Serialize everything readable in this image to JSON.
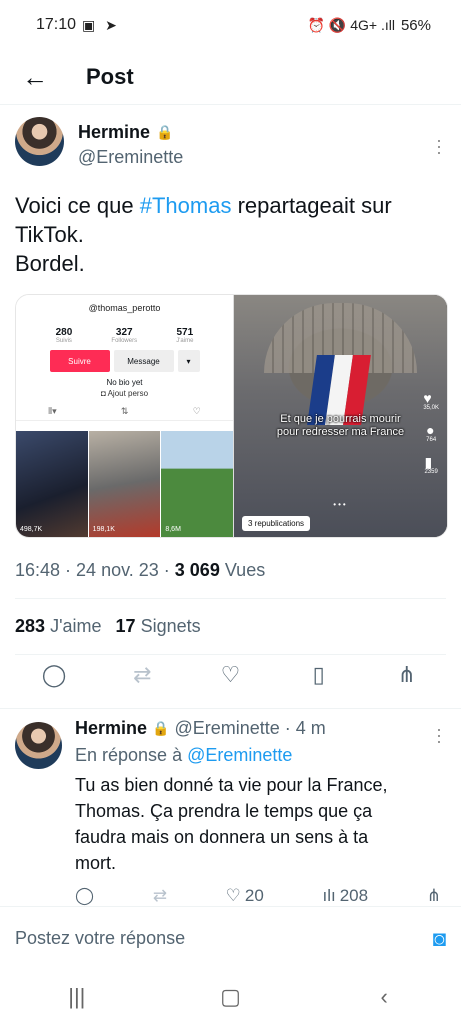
{
  "status_bar": {
    "time": "17:10",
    "left_icons": "▣ ➤",
    "right_icons": "⏰ 🔇 4G+ .ıll",
    "battery": "56%"
  },
  "header": {
    "back_icon": "arrow-left-icon",
    "title": "Post"
  },
  "tweet": {
    "author_name": "Hermine",
    "author_handle": "@Ereminette",
    "text_before": "Voici ce que ",
    "hashtag": "#Thomas",
    "text_after": " repartageait sur TikTok.\nBordel.",
    "media": {
      "tiktok_profile": {
        "handle": "@thomas_perotto",
        "stats": [
          {
            "num": "280",
            "label": "Suivis"
          },
          {
            "num": "327",
            "label": "Followers"
          },
          {
            "num": "571",
            "label": "J'aime"
          }
        ],
        "follow": "Suivre",
        "message": "Message",
        "bio": "No bio yet",
        "add": "Ajout perso",
        "videos": [
          "498,7K",
          "198,1K",
          "8,6M"
        ]
      },
      "video": {
        "caption_line1": "Et que je pourrais mourir",
        "caption_line2": "pour redresser ma France",
        "likes": "35,0K",
        "comments": "764",
        "saves": "2359",
        "reposts": "3 republications"
      }
    },
    "time": "16:48",
    "date": "24 nov. 23",
    "views_count": "3 069",
    "views_label": "Vues",
    "likes_count": "283",
    "likes_label": "J'aime",
    "bookmarks_count": "17",
    "bookmarks_label": "Signets"
  },
  "reply": {
    "author_name": "Hermine",
    "author_handle": "@Ereminette",
    "age": "· 4 m",
    "reply_prefix": "En réponse à ",
    "reply_to": "@Ereminette",
    "text": "Tu as bien donné ta vie pour la France,\nThomas. Ça prendra le temps que ça\nfaudra mais on donnera un sens à ta\nmort.",
    "likes": "20",
    "views": "208"
  },
  "compose": {
    "placeholder": "Postez votre réponse"
  }
}
